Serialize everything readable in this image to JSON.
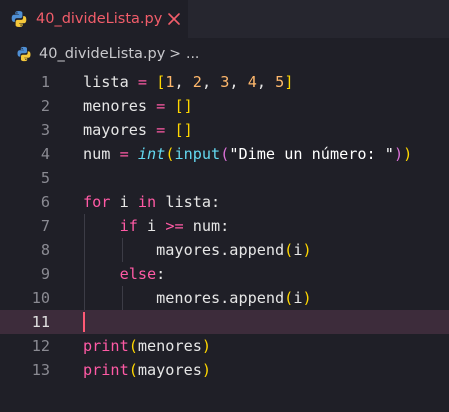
{
  "tab": {
    "filename": "40_divideLista.py",
    "file_icon": "python-icon",
    "close_icon": "close-icon"
  },
  "breadcrumb": {
    "filename": "40_divideLista.py",
    "separator": ">",
    "more": "..."
  },
  "editor": {
    "current_line": 11,
    "lines": [
      {
        "n": "1",
        "tokens": [
          [
            "tx",
            "lista "
          ],
          [
            "op",
            "="
          ],
          [
            "tx",
            " "
          ],
          [
            "b1",
            "["
          ],
          [
            "num",
            "1"
          ],
          [
            "tx",
            ", "
          ],
          [
            "num",
            "2"
          ],
          [
            "tx",
            ", "
          ],
          [
            "num",
            "3"
          ],
          [
            "tx",
            ", "
          ],
          [
            "num",
            "4"
          ],
          [
            "tx",
            ", "
          ],
          [
            "num",
            "5"
          ],
          [
            "b1",
            "]"
          ]
        ]
      },
      {
        "n": "2",
        "tokens": [
          [
            "tx",
            "menores "
          ],
          [
            "op",
            "="
          ],
          [
            "tx",
            " "
          ],
          [
            "b1",
            "[]"
          ]
        ]
      },
      {
        "n": "3",
        "tokens": [
          [
            "tx",
            "mayores "
          ],
          [
            "op",
            "="
          ],
          [
            "tx",
            " "
          ],
          [
            "b1",
            "[]"
          ]
        ]
      },
      {
        "n": "4",
        "tokens": [
          [
            "tx",
            "num "
          ],
          [
            "op",
            "="
          ],
          [
            "tx",
            " "
          ],
          [
            "it",
            "int"
          ],
          [
            "b1",
            "("
          ],
          [
            "fn",
            "input"
          ],
          [
            "b2",
            "("
          ],
          [
            "str",
            "\"Dime un número: \""
          ],
          [
            "b2",
            ")"
          ],
          [
            "b1",
            ")"
          ]
        ]
      },
      {
        "n": "5",
        "tokens": []
      },
      {
        "n": "6",
        "tokens": [
          [
            "kw",
            "for"
          ],
          [
            "tx",
            " i "
          ],
          [
            "kw",
            "in"
          ],
          [
            "tx",
            " lista:"
          ]
        ]
      },
      {
        "n": "7",
        "tokens": [
          [
            "tx",
            "    "
          ],
          [
            "kw",
            "if"
          ],
          [
            "tx",
            " i "
          ],
          [
            "op",
            ">="
          ],
          [
            "tx",
            " num:"
          ]
        ]
      },
      {
        "n": "8",
        "tokens": [
          [
            "tx",
            "        mayores.append"
          ],
          [
            "b1",
            "("
          ],
          [
            "tx",
            "i"
          ],
          [
            "b1",
            ")"
          ]
        ]
      },
      {
        "n": "9",
        "tokens": [
          [
            "tx",
            "    "
          ],
          [
            "kw",
            "else"
          ],
          [
            "tx",
            ":"
          ]
        ]
      },
      {
        "n": "10",
        "tokens": [
          [
            "tx",
            "        menores.append"
          ],
          [
            "b1",
            "("
          ],
          [
            "tx",
            "i"
          ],
          [
            "b1",
            ")"
          ]
        ]
      },
      {
        "n": "11",
        "tokens": []
      },
      {
        "n": "12",
        "tokens": [
          [
            "kw",
            "print"
          ],
          [
            "b1",
            "("
          ],
          [
            "tx",
            "menores"
          ],
          [
            "b1",
            ")"
          ]
        ]
      },
      {
        "n": "13",
        "tokens": [
          [
            "kw",
            "print"
          ],
          [
            "b1",
            "("
          ],
          [
            "tx",
            "mayores"
          ],
          [
            "b1",
            ")"
          ]
        ]
      }
    ]
  },
  "colors": {
    "background": "#1f1f27",
    "tab_label": "#f25d6a",
    "keyword": "#ff5aa5",
    "number": "#ffb86c",
    "function": "#63d8f0",
    "bracket_level1": "#ffd700",
    "bracket_level2": "#da70d6",
    "current_line_bg": "#3d2c3b",
    "cursor": "#ff5a75"
  }
}
